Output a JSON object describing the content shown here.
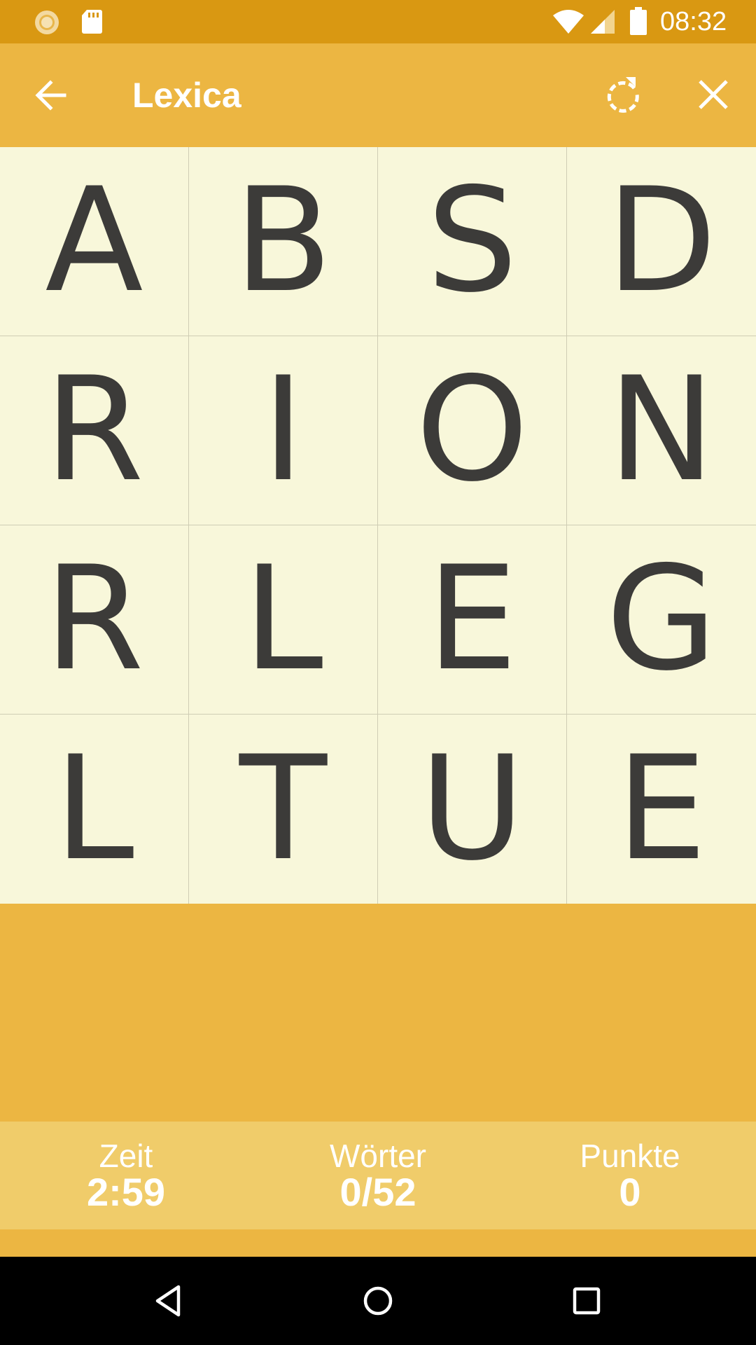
{
  "status_bar": {
    "time": "08:32",
    "icons": [
      "sun-notification-icon",
      "sd-card-icon",
      "wifi-icon",
      "cell-signal-icon",
      "battery-icon"
    ]
  },
  "app_bar": {
    "title": "Lexica",
    "icons": [
      "back-arrow-icon",
      "refresh-icon",
      "close-icon"
    ]
  },
  "board": {
    "tiles": [
      {
        "letter": "A"
      },
      {
        "letter": "B"
      },
      {
        "letter": "S"
      },
      {
        "letter": "D"
      },
      {
        "letter": "R"
      },
      {
        "letter": "I"
      },
      {
        "letter": "O"
      },
      {
        "letter": "N"
      },
      {
        "letter": "R"
      },
      {
        "letter": "L"
      },
      {
        "letter": "E"
      },
      {
        "letter": "G"
      },
      {
        "letter": "L"
      },
      {
        "letter": "T"
      },
      {
        "letter": "U"
      },
      {
        "letter": "E"
      }
    ]
  },
  "stats": {
    "time": {
      "label": "Zeit",
      "value": "2:59"
    },
    "words": {
      "label": "Wörter",
      "value": "0/52"
    },
    "points": {
      "label": "Punkte",
      "value": "0"
    }
  },
  "nav_bar": {
    "icons": [
      "back-triangle-icon",
      "home-circle-icon",
      "recents-square-icon"
    ]
  },
  "colors": {
    "status_bar": "#D99812",
    "app_bar": "#ECB642",
    "board_background": "#F8F7DA",
    "letter": "#3C3B39",
    "stats_background": "#F0CC6A"
  }
}
